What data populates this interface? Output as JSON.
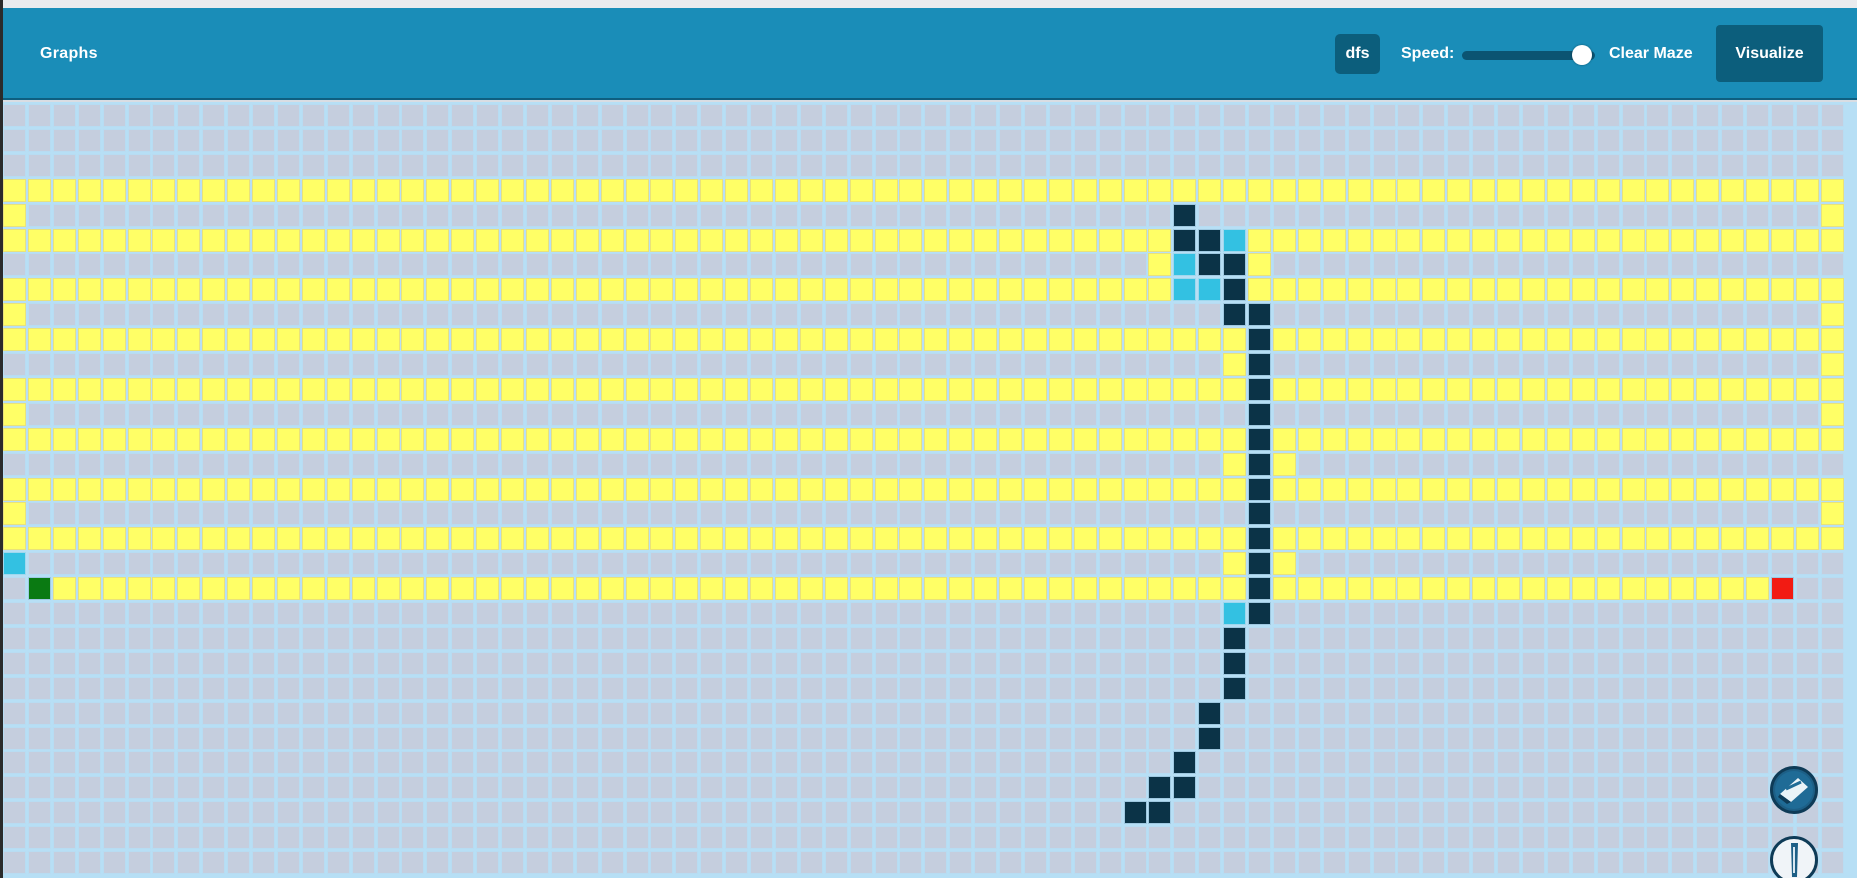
{
  "navbar": {
    "brand": "Graphs",
    "algorithm_label": "dfs",
    "speed_label": "Speed:",
    "speed_value": 0.9,
    "clear_label": "Clear Maze",
    "visualize_label": "Visualize"
  },
  "colors": {
    "navbar": "#1a8db8",
    "button": "#0c5e7c",
    "empty_cell": "#c5cede",
    "visited_cell": "#ffff66",
    "wall_cell": "#0b3347",
    "frontier_cell": "#33c1e2",
    "start_cell": "#0a7a12",
    "target_cell": "#f21b13"
  },
  "maze": {
    "columns": 74,
    "rows": 31,
    "start": [
      19,
      1
    ],
    "target": [
      19,
      71
    ],
    "visited_rows": [
      3,
      5,
      7,
      9,
      11,
      13,
      15,
      17
    ],
    "visited_row_19_range": [
      2,
      70
    ],
    "visited_singles": [
      [
        4,
        0
      ],
      [
        4,
        73
      ],
      [
        6,
        46
      ],
      [
        6,
        50
      ],
      [
        8,
        0
      ],
      [
        8,
        73
      ],
      [
        10,
        49
      ],
      [
        10,
        73
      ],
      [
        12,
        0
      ],
      [
        12,
        73
      ],
      [
        14,
        49
      ],
      [
        14,
        51
      ],
      [
        16,
        0
      ],
      [
        16,
        73
      ],
      [
        18,
        49
      ],
      [
        18,
        51
      ]
    ],
    "frontier_cells": [
      [
        5,
        49
      ],
      [
        6,
        47
      ],
      [
        7,
        47
      ],
      [
        7,
        48
      ],
      [
        18,
        0
      ],
      [
        20,
        49
      ]
    ],
    "wall_cells": [
      [
        4,
        47
      ],
      [
        5,
        47
      ],
      [
        5,
        48
      ],
      [
        6,
        48
      ],
      [
        6,
        49
      ],
      [
        7,
        49
      ],
      [
        8,
        49
      ],
      [
        8,
        50
      ],
      [
        9,
        50
      ],
      [
        10,
        50
      ],
      [
        11,
        50
      ],
      [
        12,
        50
      ],
      [
        13,
        50
      ],
      [
        14,
        50
      ],
      [
        15,
        50
      ],
      [
        16,
        50
      ],
      [
        17,
        50
      ],
      [
        18,
        50
      ],
      [
        19,
        50
      ],
      [
        20,
        50
      ],
      [
        21,
        49
      ],
      [
        22,
        49
      ],
      [
        23,
        49
      ],
      [
        24,
        48
      ],
      [
        25,
        48
      ],
      [
        26,
        47
      ],
      [
        27,
        46
      ],
      [
        27,
        47
      ],
      [
        28,
        45
      ],
      [
        28,
        46
      ]
    ]
  },
  "floating_buttons": [
    {
      "icon": "eraser-icon"
    },
    {
      "icon": "pencil-icon"
    }
  ]
}
